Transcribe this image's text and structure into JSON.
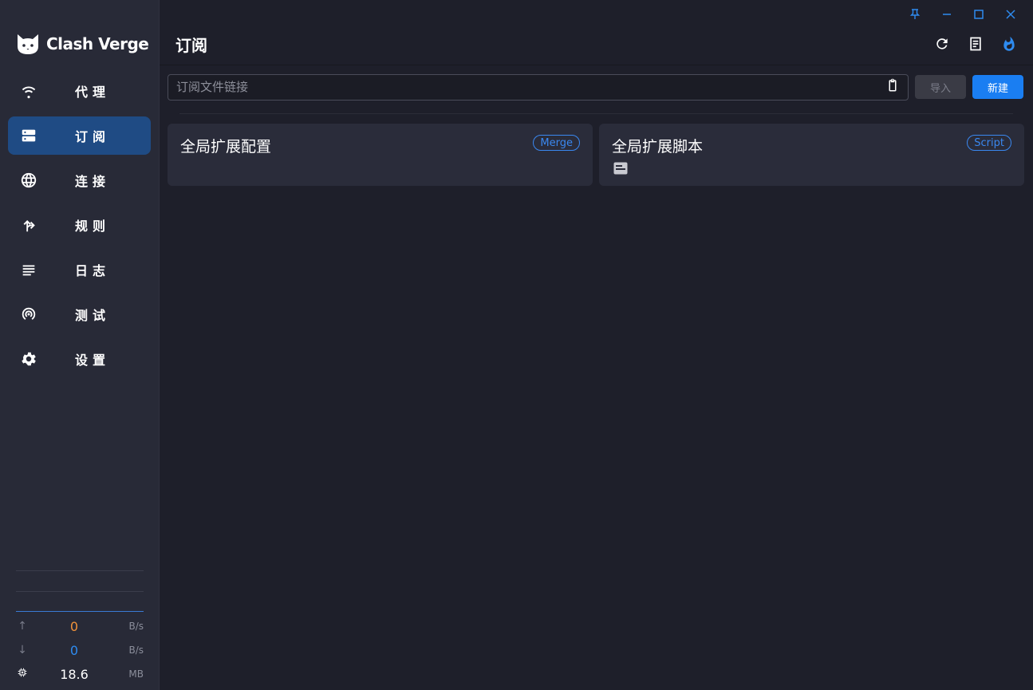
{
  "app": {
    "name": "Clash Verge"
  },
  "sidebar": {
    "items": [
      {
        "label": "代理",
        "icon": "wifi-icon"
      },
      {
        "label": "订阅",
        "icon": "server-icon",
        "active": true
      },
      {
        "label": "连接",
        "icon": "globe-icon"
      },
      {
        "label": "规则",
        "icon": "fork-icon"
      },
      {
        "label": "日志",
        "icon": "list-icon"
      },
      {
        "label": "测试",
        "icon": "radar-icon"
      },
      {
        "label": "设置",
        "icon": "gear-icon"
      }
    ],
    "traffic": {
      "upload": {
        "value": "0",
        "unit": "B/s",
        "color": "#f0923a"
      },
      "download": {
        "value": "0",
        "unit": "B/s",
        "color": "#2e8bf0"
      },
      "memory": {
        "value": "18.6",
        "unit": "MB"
      }
    }
  },
  "header": {
    "title": "订阅"
  },
  "toolbar": {
    "url_placeholder": "订阅文件链接",
    "import_label": "导入",
    "new_label": "新建"
  },
  "profiles": [
    {
      "title": "全局扩展配置",
      "badge": "Merge"
    },
    {
      "title": "全局扩展脚本",
      "badge": "Script"
    }
  ],
  "colors": {
    "accent": "#1a7ef2",
    "active_nav": "#1f4b84",
    "sidebar_bg": "#282a37",
    "main_bg": "#1e1f2a"
  }
}
